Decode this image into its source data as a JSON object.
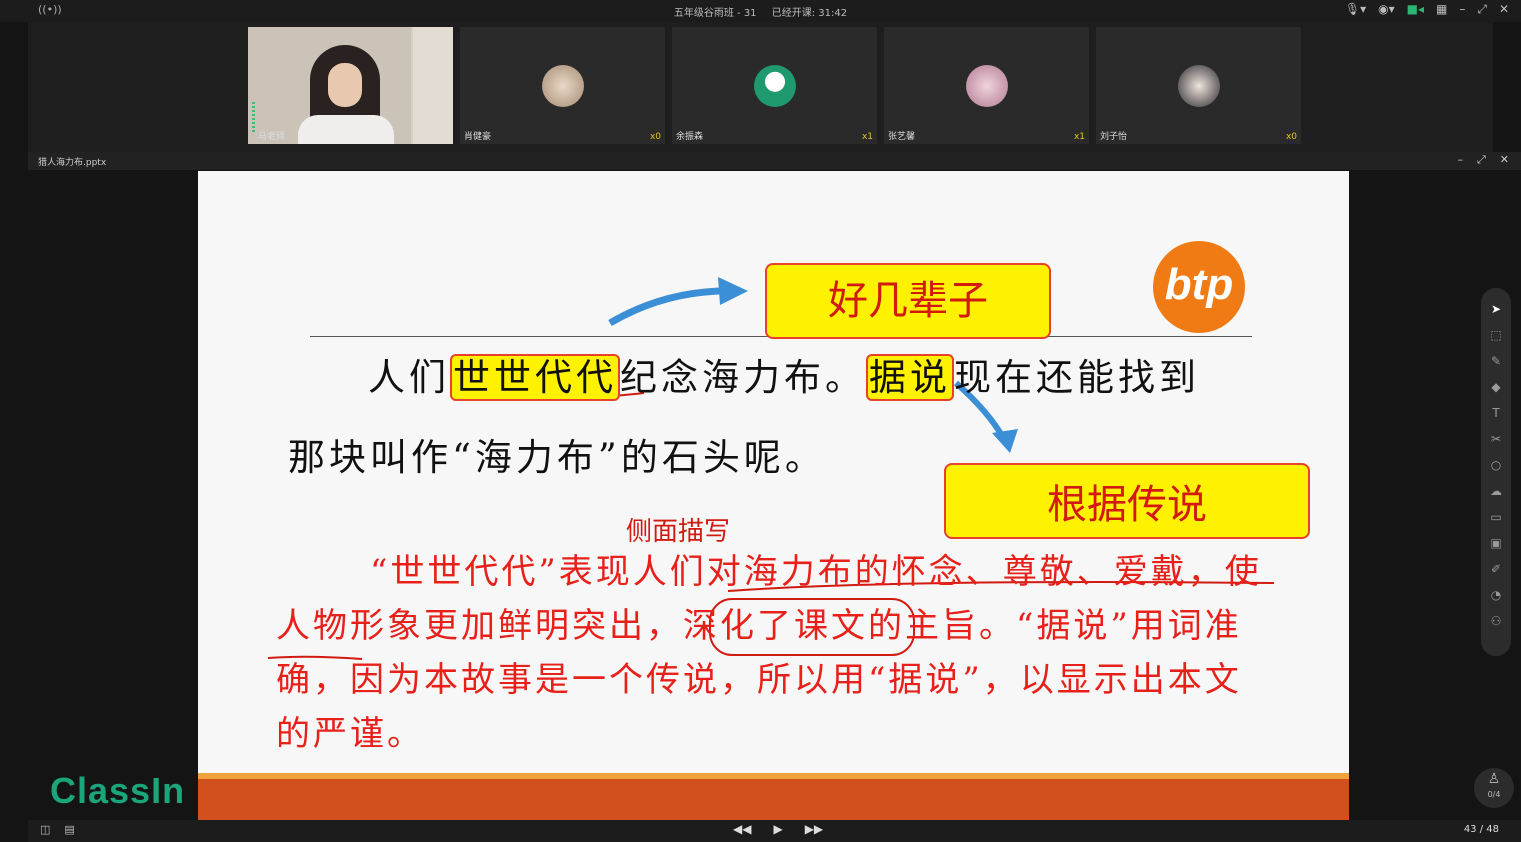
{
  "window": {
    "title": "五年级谷雨班 - 31",
    "class_timer": "已经开课: 31:42"
  },
  "participants": [
    {
      "name": "马老师",
      "count": "",
      "role": "teacher"
    },
    {
      "name": "肖健豪",
      "count": "x0"
    },
    {
      "name": "余振森",
      "count": "x1"
    },
    {
      "name": "张艺馨",
      "count": "x1"
    },
    {
      "name": "刘子怡",
      "count": "x0"
    }
  ],
  "file": {
    "name": "猎人海力布.pptx"
  },
  "slide": {
    "box_top": "好几辈子",
    "box_right": "根据传说",
    "logo": "btp",
    "line1": {
      "pre": "人们",
      "hl1": "世世代代",
      "mid": "纪念海力布。",
      "hl2": "据说",
      "post": "现在还能找到"
    },
    "line2": "那块叫作“海力布”的石头呢。",
    "side_label": "侧面描写",
    "paragraph": "“世世代代”表现人们对海力布的怀念、尊敬、爱戴，使人物形象更加鲜明突出，深化了课文的主旨。“据说”用词准确，因为本故事是一个传说，所以用“据说”，以显示出本文的严谨。"
  },
  "app_logo": "ClassIn",
  "toolbar_icons": [
    "pointer-icon",
    "select-icon",
    "laser-icon",
    "pen-icon",
    "text-icon",
    "scissors-icon",
    "shape-icon",
    "cloud-icon",
    "toolbox-icon",
    "save-icon",
    "edit-icon",
    "chat-icon",
    "users-icon"
  ],
  "stage": {
    "label": "0/4"
  },
  "pager": {
    "current": "43",
    "total": "48",
    "text": "43 / 48"
  },
  "colors": {
    "accent_green": "#2bb673",
    "slide_red": "#e8201a",
    "highlight_yellow": "#fff200",
    "orange": "#d2501e"
  }
}
